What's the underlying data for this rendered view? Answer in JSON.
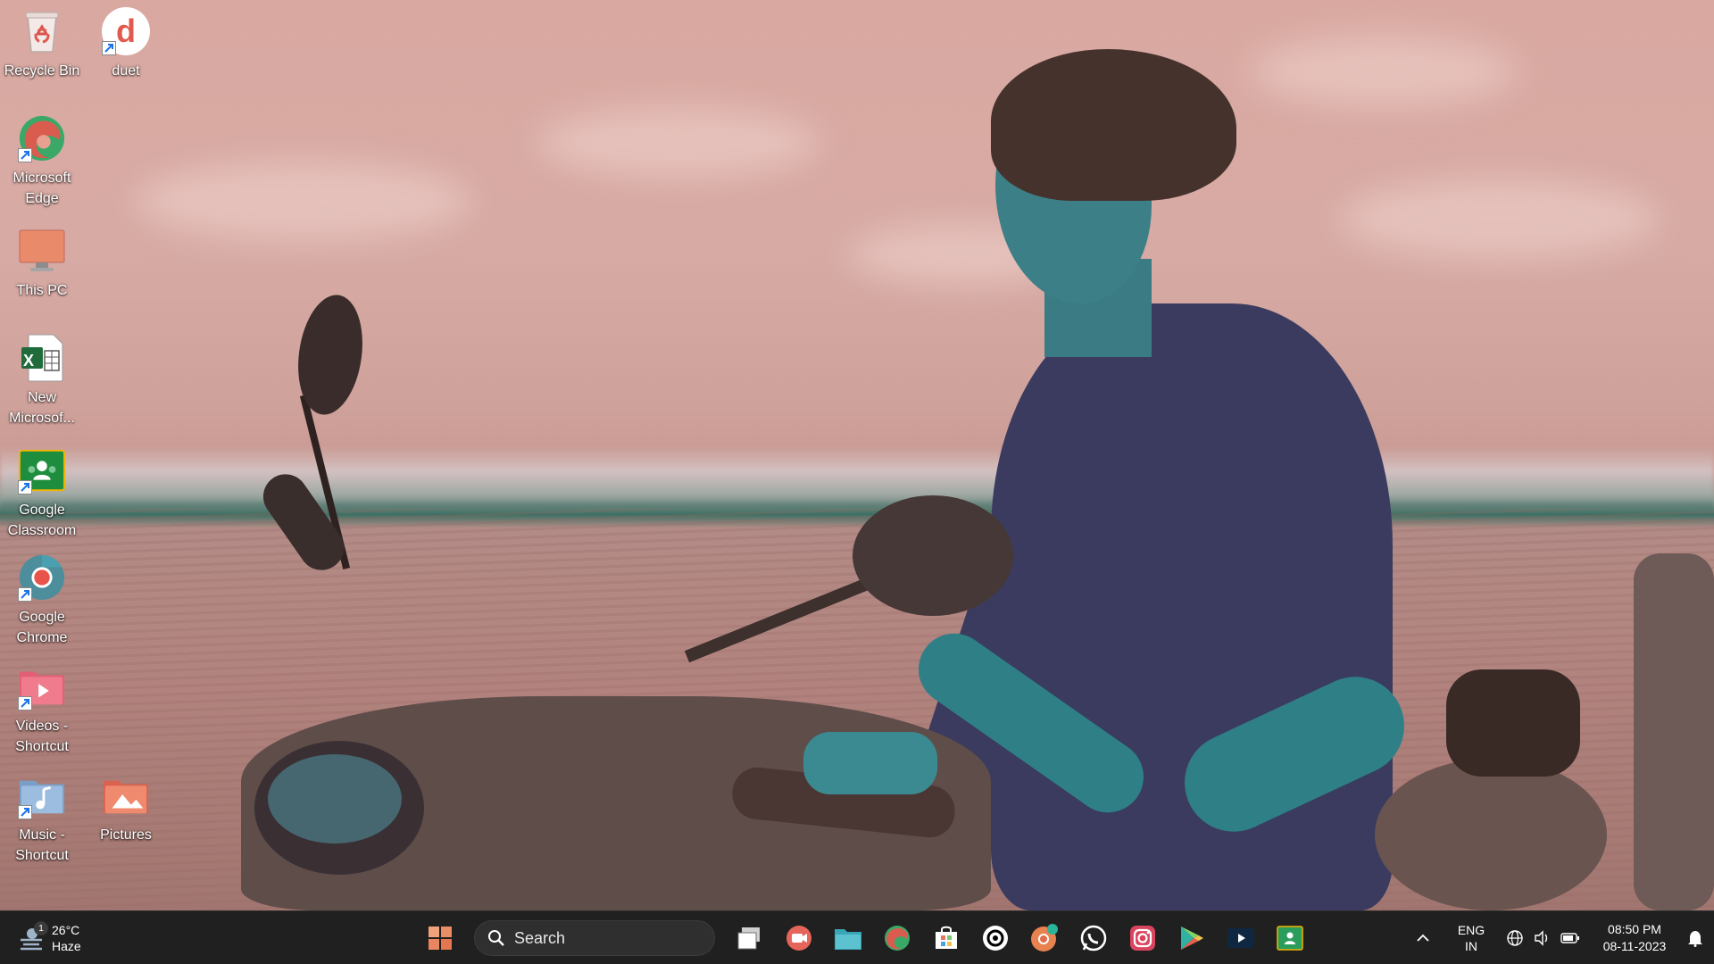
{
  "desktop": {
    "icons": [
      {
        "label": "Recycle Bin",
        "icon": "recycle-bin-icon"
      },
      {
        "label": "duet",
        "icon": "duet-icon",
        "letter": "d"
      },
      {
        "label": "Microsoft Edge",
        "icon": "edge-icon"
      },
      {
        "label": "This PC",
        "icon": "monitor-icon"
      },
      {
        "label": "New Microsof...",
        "icon": "excel-icon",
        "letter": "X"
      },
      {
        "label": "Google Classroom",
        "icon": "classroom-icon"
      },
      {
        "label": "Google Chrome",
        "icon": "chrome-icon"
      },
      {
        "label": "Videos - Shortcut",
        "icon": "videos-folder-icon"
      },
      {
        "label": "Music - Shortcut",
        "icon": "music-folder-icon"
      },
      {
        "label": "Pictures",
        "icon": "pictures-folder-icon"
      }
    ]
  },
  "taskbar": {
    "weather": {
      "temperature": "26°C",
      "condition": "Haze",
      "badge": "1"
    },
    "search_label": "Search",
    "pinned_apps": [
      "start-icon",
      "task-view-icon",
      "meet-icon",
      "file-explorer-icon",
      "edge-icon",
      "microsoft-store-icon",
      "threads-icon",
      "chrome-canary-icon",
      "whatsapp-icon",
      "instagram-icon",
      "play-store-icon",
      "prime-video-icon",
      "classroom-icon"
    ],
    "tray": {
      "language": "ENG",
      "region": "IN",
      "time": "08:50 PM",
      "date": "08-11-2023"
    }
  },
  "colors": {
    "taskbar_bg": "#202020",
    "accent": "#0078d4"
  }
}
